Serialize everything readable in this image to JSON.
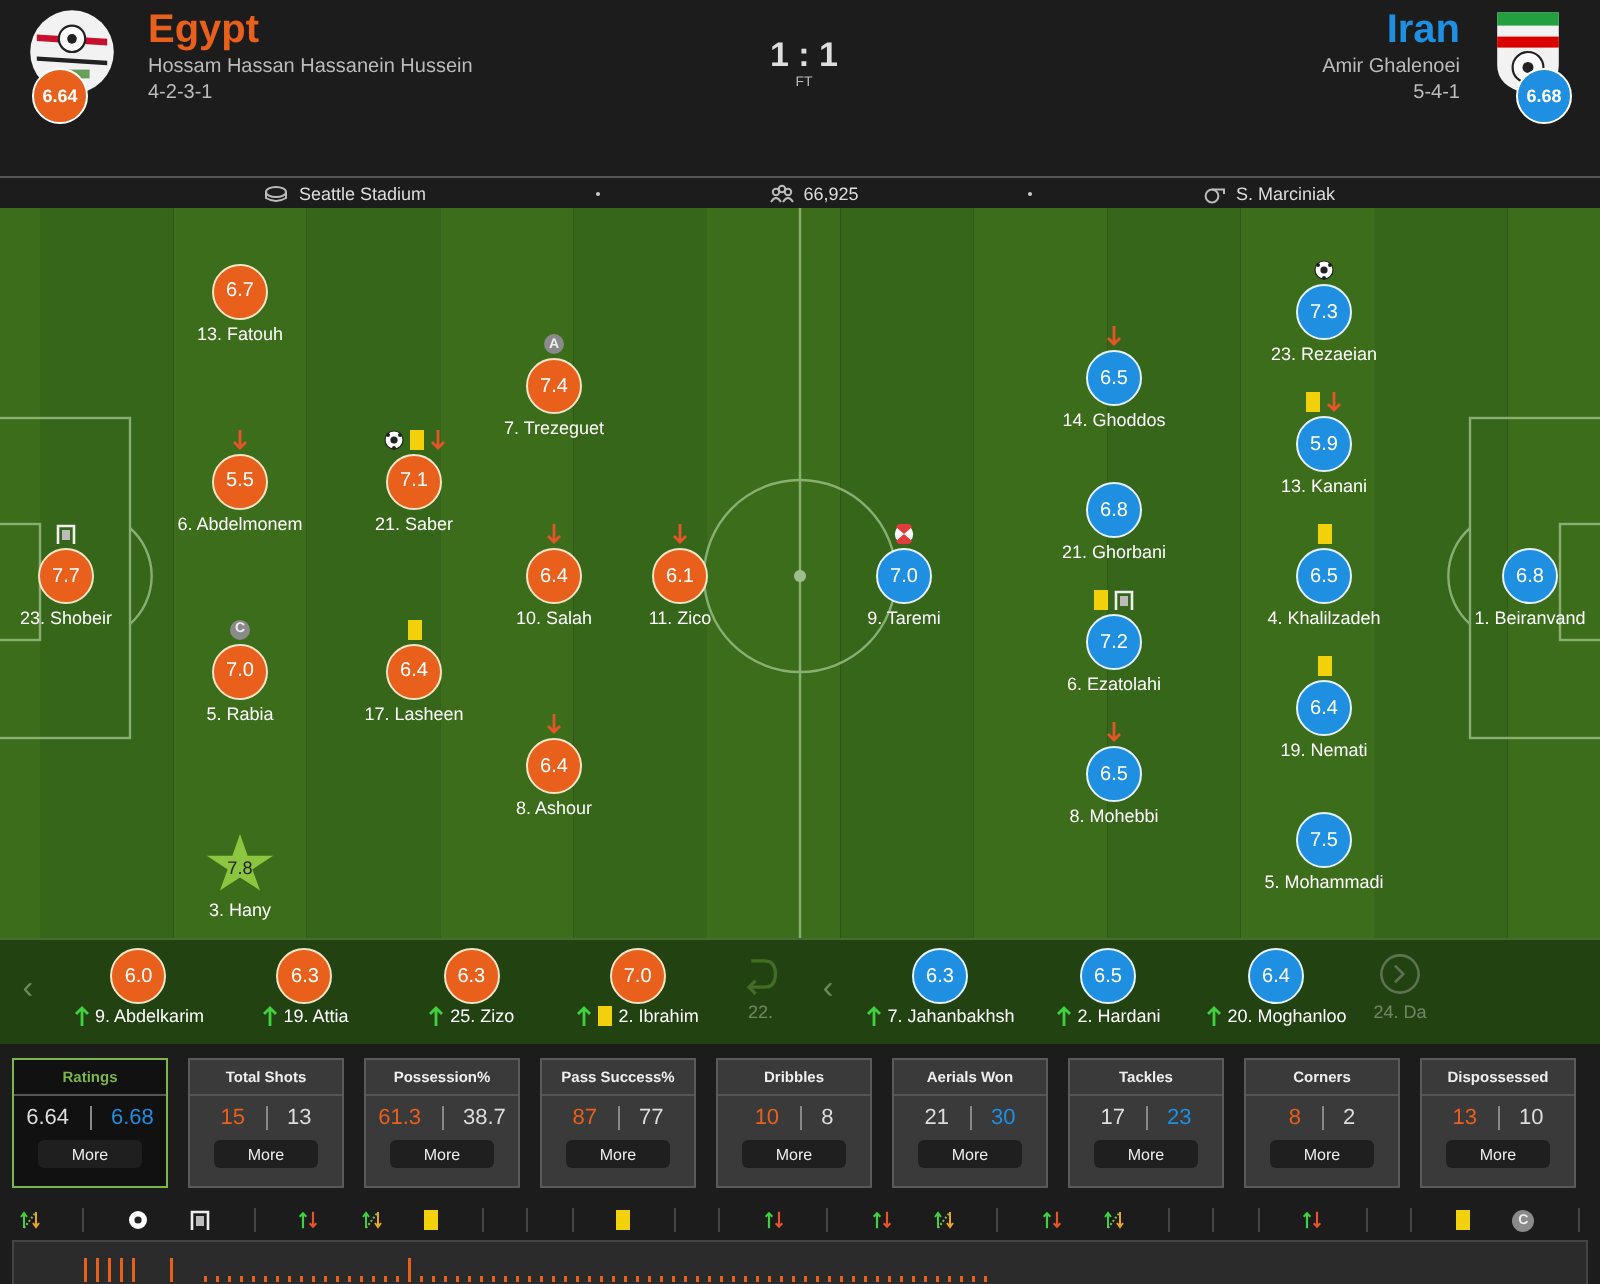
{
  "home": {
    "name": "Egypt",
    "rating": "6.64",
    "manager": "Hossam Hassan Hassanein Hussein",
    "formation": "4-2-3-1"
  },
  "score": "1 : 1",
  "status": "FT",
  "away": {
    "name": "Iran",
    "rating": "6.68",
    "manager": "Amir Ghalenoei",
    "formation": "5-4-1"
  },
  "info": {
    "venue": "Seattle Stadium",
    "attendance": "66,925",
    "referee": "S. Marciniak"
  },
  "lineups": [
    {
      "lines": [
        [
          {
            "name": "23. Shobeir",
            "rating": "7.7",
            "man_of_match": false,
            "events": [
              {
                "kind": "post"
              }
            ]
          }
        ],
        [
          {
            "name": "13. Fatouh",
            "rating": "6.7",
            "man_of_match": false
          },
          {
            "name": "6. Abdelmonem",
            "rating": "5.5",
            "man_of_match": false,
            "events": [
              {
                "kind": "sub_off"
              }
            ]
          },
          {
            "name": "5. Rabia",
            "rating": "7.0",
            "man_of_match": false,
            "events": [
              {
                "kind": "captain",
                "text": "C"
              }
            ]
          },
          {
            "name": "3. Hany",
            "rating": "7.8",
            "man_of_match": true
          }
        ],
        [
          {
            "name": "21. Saber",
            "rating": "7.1",
            "man_of_match": false,
            "events": [
              {
                "kind": "goal"
              },
              {
                "kind": "yellow"
              },
              {
                "kind": "sub_off"
              }
            ]
          },
          {
            "name": "17. Lasheen",
            "rating": "6.4",
            "man_of_match": false,
            "events": [
              {
                "kind": "yellow"
              }
            ]
          }
        ],
        [
          {
            "name": "7. Trezeguet",
            "rating": "7.4",
            "man_of_match": false,
            "events": [
              {
                "kind": "assist",
                "text": "A"
              }
            ]
          },
          {
            "name": "10. Salah",
            "rating": "6.4",
            "man_of_match": false,
            "events": [
              {
                "kind": "sub_off"
              }
            ]
          },
          {
            "name": "8. Ashour",
            "rating": "6.4",
            "man_of_match": false,
            "events": [
              {
                "kind": "sub_off"
              }
            ]
          }
        ],
        [
          {
            "name": "11. Zico",
            "rating": "6.1",
            "man_of_match": false,
            "events": [
              {
                "kind": "sub_off"
              }
            ]
          }
        ]
      ]
    },
    {
      "lines": [
        [
          {
            "name": "9. Taremi",
            "rating": "7.0",
            "man_of_match": false,
            "events": [
              {
                "kind": "penalty"
              }
            ]
          }
        ],
        [
          {
            "name": "14. Ghoddos",
            "rating": "6.5",
            "man_of_match": false,
            "events": [
              {
                "kind": "sub_off"
              }
            ]
          },
          {
            "name": "21. Ghorbani",
            "rating": "6.8",
            "man_of_match": false
          },
          {
            "name": "6. Ezatolahi",
            "rating": "7.2",
            "man_of_match": false,
            "events": [
              {
                "kind": "yellow"
              },
              {
                "kind": "post"
              }
            ]
          },
          {
            "name": "8. Mohebbi",
            "rating": "6.5",
            "man_of_match": false,
            "events": [
              {
                "kind": "sub_off"
              }
            ]
          }
        ],
        [
          {
            "name": "23. Rezaeian",
            "rating": "7.3",
            "man_of_match": false,
            "events": [
              {
                "kind": "goal"
              }
            ]
          },
          {
            "name": "13. Kanani",
            "rating": "5.9",
            "man_of_match": false,
            "events": [
              {
                "kind": "yellow"
              },
              {
                "kind": "sub_off"
              }
            ]
          },
          {
            "name": "4. Khalilzadeh",
            "rating": "6.5",
            "man_of_match": false,
            "events": [
              {
                "kind": "yellow"
              }
            ]
          },
          {
            "name": "19. Nemati",
            "rating": "6.4",
            "man_of_match": false,
            "events": [
              {
                "kind": "yellow"
              }
            ]
          },
          {
            "name": "5. Mohammadi",
            "rating": "7.5",
            "man_of_match": false
          }
        ],
        [
          {
            "name": "1. Beiranvand",
            "rating": "6.8",
            "man_of_match": false
          }
        ]
      ]
    }
  ],
  "substitutes": [
    {
      "prev": "‹",
      "players": [
        {
          "name": "9. Abdelkarim",
          "rating": "6.0",
          "dimmed": false,
          "events": [
            {
              "kind": "sub_on"
            }
          ]
        },
        {
          "name": "19. Attia",
          "rating": "6.3",
          "dimmed": false,
          "events": [
            {
              "kind": "sub_on"
            }
          ]
        },
        {
          "name": "25. Zizo",
          "rating": "6.3",
          "dimmed": false,
          "events": [
            {
              "kind": "sub_on"
            }
          ]
        },
        {
          "name": "2. Ibrahim",
          "rating": "7.0",
          "dimmed": false,
          "events": [
            {
              "kind": "sub_on"
            },
            {
              "kind": "yellow"
            }
          ]
        },
        {
          "name": "22.",
          "dimmed": true
        }
      ]
    },
    {
      "prev": "‹",
      "players": [
        {
          "name": "7. Jahanbakhsh",
          "rating": "6.3",
          "dimmed": false,
          "events": [
            {
              "kind": "sub_on"
            }
          ]
        },
        {
          "name": "2. Hardani",
          "rating": "6.5",
          "dimmed": false,
          "events": [
            {
              "kind": "sub_on"
            }
          ]
        },
        {
          "name": "20. Moghanloo",
          "rating": "6.4",
          "dimmed": false,
          "events": [
            {
              "kind": "sub_on"
            }
          ]
        },
        {
          "name": "24. Da",
          "dimmed": true
        }
      ]
    }
  ],
  "stats": [
    {
      "title": "Ratings",
      "home": "6.64",
      "away": "6.68",
      "home_highlighted": false,
      "away_highlighted": true,
      "selected": true,
      "more": "More"
    },
    {
      "title": "Total Shots",
      "home": "15",
      "away": "13",
      "home_highlighted": true,
      "away_highlighted": false,
      "selected": false,
      "more": "More"
    },
    {
      "title": "Possession%",
      "home": "61.3",
      "away": "38.7",
      "home_highlighted": true,
      "away_highlighted": false,
      "selected": false,
      "more": "More"
    },
    {
      "title": "Pass Success%",
      "home": "87",
      "away": "77",
      "home_highlighted": true,
      "away_highlighted": false,
      "selected": false,
      "more": "More"
    },
    {
      "title": "Dribbles",
      "home": "10",
      "away": "8",
      "home_highlighted": true,
      "away_highlighted": false,
      "selected": false,
      "more": "More"
    },
    {
      "title": "Aerials Won",
      "home": "21",
      "away": "30",
      "home_highlighted": false,
      "away_highlighted": true,
      "selected": false,
      "more": "More"
    },
    {
      "title": "Tackles",
      "home": "17",
      "away": "23",
      "home_highlighted": false,
      "away_highlighted": true,
      "selected": false,
      "more": "More"
    },
    {
      "title": "Corners",
      "home": "8",
      "away": "2",
      "home_highlighted": true,
      "away_highlighted": false,
      "selected": false,
      "more": "More"
    },
    {
      "title": "Dispossessed",
      "home": "13",
      "away": "10",
      "home_highlighted": true,
      "away_highlighted": false,
      "selected": false,
      "more": "More"
    }
  ],
  "timeline": [
    {
      "kind": "swap"
    },
    {
      "kind": "divider"
    },
    {
      "kind": "goal"
    },
    {
      "kind": "post"
    },
    {
      "kind": "divider"
    },
    {
      "kind": "subs"
    },
    {
      "kind": "swap"
    },
    {
      "kind": "yellow"
    },
    {
      "kind": "divider"
    },
    {
      "kind": "divider"
    },
    {
      "kind": "divider"
    },
    {
      "kind": "yellow"
    },
    {
      "kind": "divider"
    },
    {
      "kind": "divider"
    },
    {
      "kind": "subs"
    },
    {
      "kind": "divider"
    },
    {
      "kind": "subs"
    },
    {
      "kind": "swap"
    },
    {
      "kind": "divider"
    },
    {
      "kind": "subs"
    },
    {
      "kind": "swap"
    },
    {
      "kind": "divider"
    },
    {
      "kind": "divider"
    },
    {
      "kind": "divider"
    },
    {
      "kind": "subs"
    },
    {
      "kind": "divider"
    },
    {
      "kind": "divider"
    },
    {
      "kind": "yellow"
    },
    {
      "kind": "captain",
      "text": "C"
    },
    {
      "kind": "divider"
    }
  ]
}
